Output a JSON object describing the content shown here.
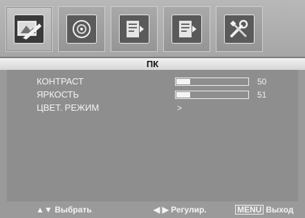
{
  "tabs": [
    {
      "icon": "picture-icon",
      "active": true
    },
    {
      "icon": "sound-icon",
      "active": false
    },
    {
      "icon": "setup-icon",
      "active": false
    },
    {
      "icon": "option-icon",
      "active": false
    },
    {
      "icon": "tools-icon",
      "active": false
    }
  ],
  "section": {
    "title": "ПК"
  },
  "settings": [
    {
      "label": "КОНТРАСТ",
      "value": "50",
      "level": 50
    },
    {
      "label": "ЯРКОСТЬ",
      "value": "51",
      "level": 51
    },
    {
      "label": "ЦВЕТ. РЕЖИМ",
      "arrow": ">"
    }
  ],
  "footer": {
    "select_hint": "▲▼ Выбрать",
    "adjust_hint": "◀ ▶ Регулир.",
    "menu_key": "MENU",
    "exit_hint": "Выход"
  }
}
